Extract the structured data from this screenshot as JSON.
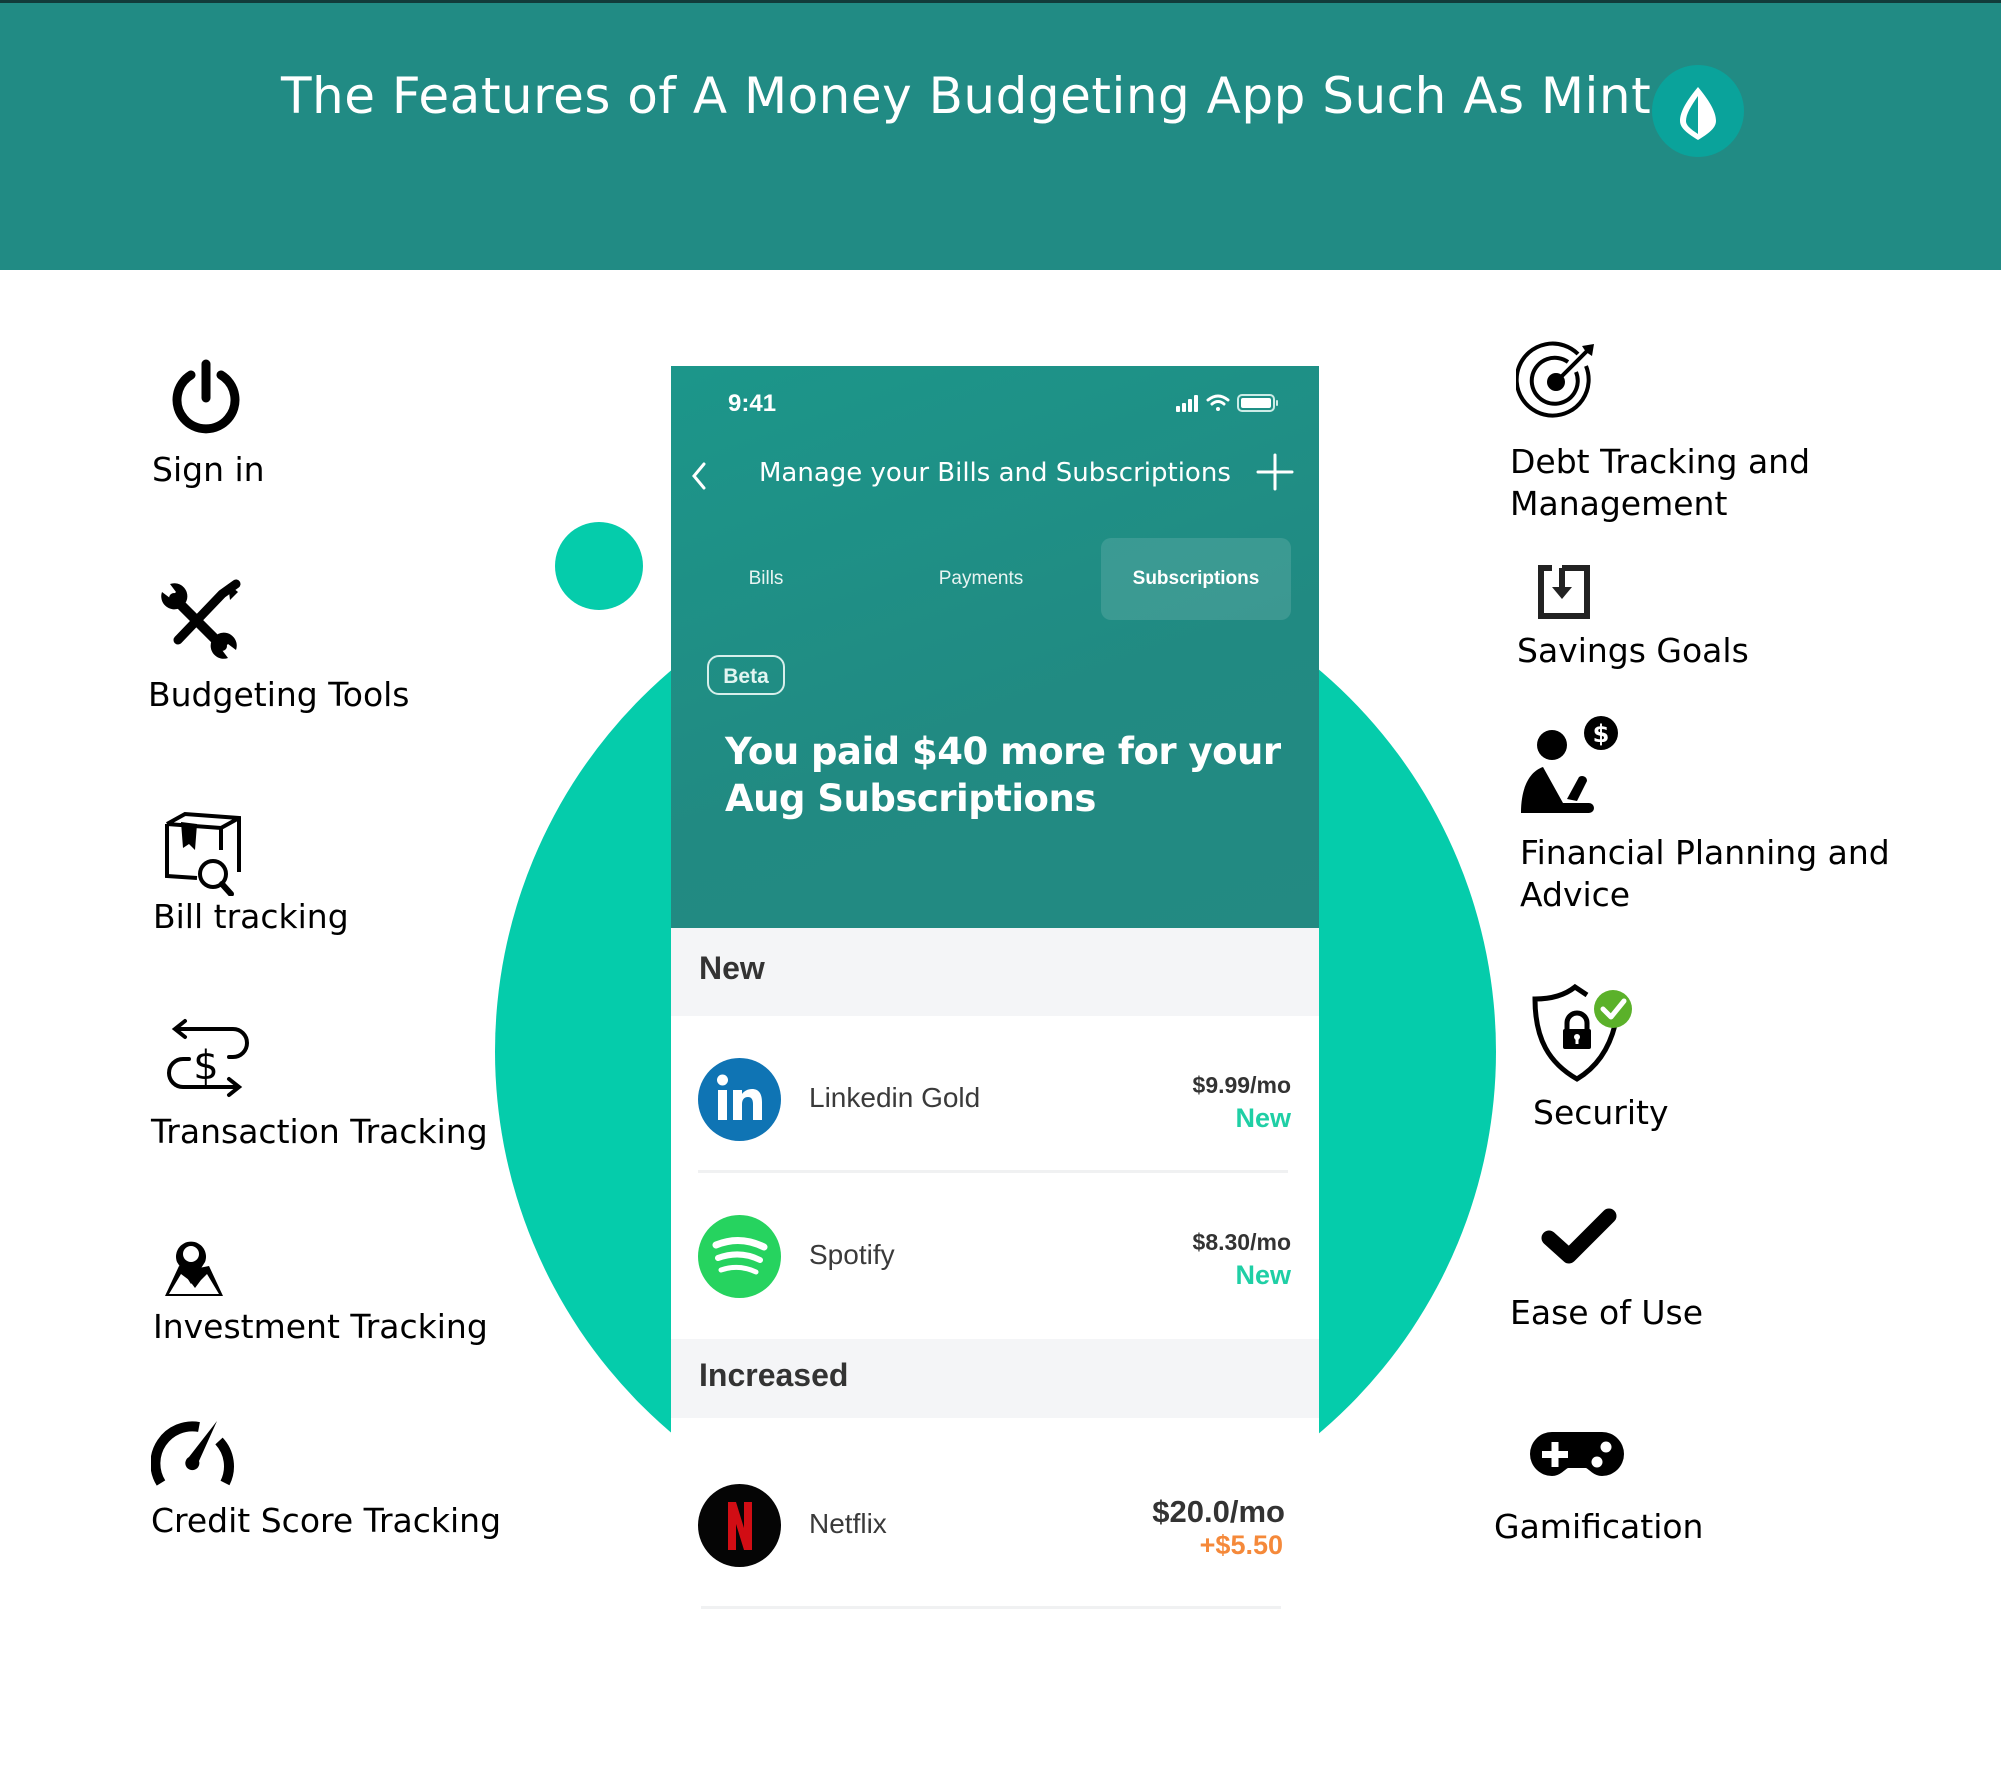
{
  "header": {
    "title": "The Features of A Money Budgeting App Such As Mint",
    "logo_icon": "mint-leaf-icon"
  },
  "colors": {
    "header_bg": "#218b84",
    "accent_circle": "#05ccab",
    "logo_bg": "#0aa39b",
    "new_status": "#1fcfa5",
    "increase_status": "#f5893a",
    "security_check": "#5bb12a"
  },
  "left_features": [
    {
      "label": "Sign in",
      "icon": "power-icon"
    },
    {
      "label": "Budgeting Tools",
      "icon": "wrench-screwdriver-icon"
    },
    {
      "label": "Bill tracking",
      "icon": "box-search-icon"
    },
    {
      "label": "Transaction Tracking",
      "icon": "dollar-exchange-icon"
    },
    {
      "label": "Investment Tracking",
      "icon": "map-pin-icon"
    },
    {
      "label": "Credit Score Tracking",
      "icon": "speedometer-icon"
    }
  ],
  "right_features": [
    {
      "label_line1": "Debt Tracking and",
      "label_line2": "Management",
      "icon": "target-icon"
    },
    {
      "label": "Savings Goals",
      "icon": "save-download-icon"
    },
    {
      "label_line1": "Financial Planning and",
      "label_line2": "Advice",
      "icon": "person-dollar-icon"
    },
    {
      "label": "Security",
      "icon": "shield-lock-icon"
    },
    {
      "label": "Ease of Use",
      "icon": "checkmark-icon"
    },
    {
      "label": "Gamification",
      "icon": "gamepad-icon"
    }
  ],
  "phone": {
    "status_time": "9:41",
    "nav_title": "Manage your Bills and Subscriptions",
    "tabs": [
      {
        "label": "Bills",
        "active": false
      },
      {
        "label": "Payments",
        "active": false
      },
      {
        "label": "Subscriptions",
        "active": true
      }
    ],
    "badge": "Beta",
    "headline_line1": "You paid $40 more for your",
    "headline_line2": "Aug Subscriptions",
    "sections": [
      {
        "title": "New",
        "items": [
          {
            "name": "Linkedin Gold",
            "price": "$9.99/mo",
            "status": "New",
            "logo": "linkedin-logo"
          },
          {
            "name": "Spotify",
            "price": "$8.30/mo",
            "status": "New",
            "logo": "spotify-logo"
          }
        ]
      },
      {
        "title": "Increased",
        "items": [
          {
            "name": "Netflix",
            "price": "$20.0/mo",
            "status": "+$5.50",
            "logo": "netflix-logo"
          }
        ]
      }
    ]
  }
}
